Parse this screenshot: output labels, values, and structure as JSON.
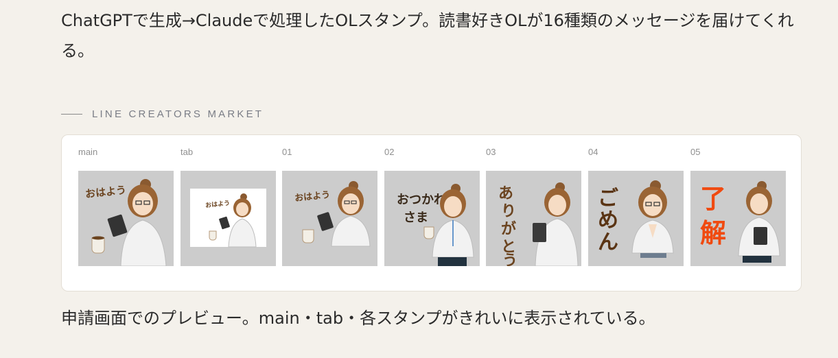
{
  "intro_text": "ChatGPTで生成→Claudeで処理したOLスタンプ。読書好きOLが16種類のメッセージを届けてくれる。",
  "section_label": "LINE CREATORS MARKET",
  "stamps": [
    {
      "name": "main",
      "text": "おはよう",
      "text_color": "#6b4420"
    },
    {
      "name": "tab",
      "text": "おはよう",
      "text_color": "#6b4420"
    },
    {
      "name": "01",
      "text": "おはよう",
      "text_color": "#6b4420"
    },
    {
      "name": "02",
      "text": "おつかれさま",
      "text_color": "#3a2a1a"
    },
    {
      "name": "03",
      "text": "ありがとう",
      "text_color": "#6b4420"
    },
    {
      "name": "04",
      "text": "ごめん",
      "text_color": "#5a3414"
    },
    {
      "name": "05",
      "text": "了解",
      "text_color": "#f04a10"
    }
  ],
  "caption_text": "申請画面でのプレビュー。main・tab・各スタンプがきれいに表示されている。",
  "colors": {
    "background": "#f4f1eb",
    "panel": "#ffffff",
    "stamp_bg": "#cccccc",
    "tab_inner_bg": "#ffffff",
    "label": "#7a7d86"
  }
}
